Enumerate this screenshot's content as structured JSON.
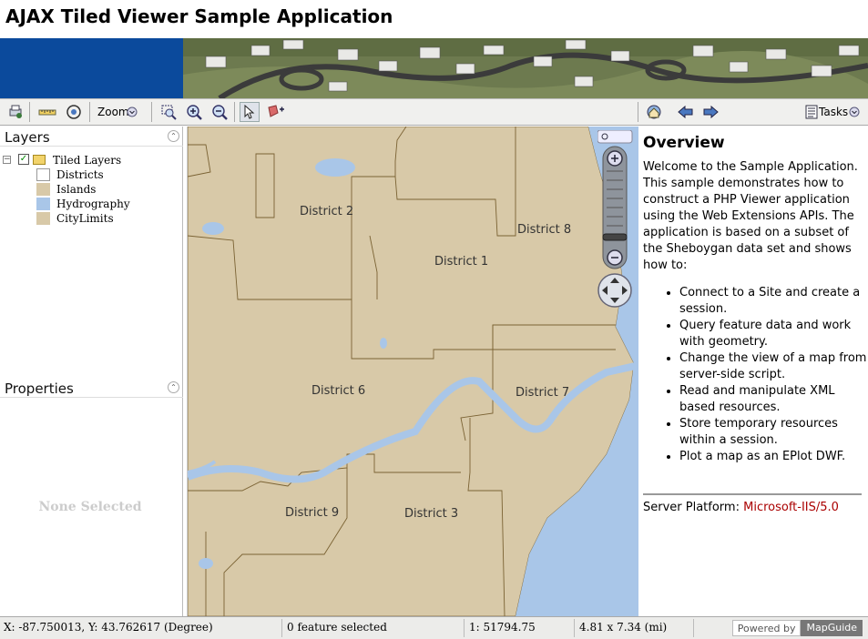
{
  "app": {
    "title": "AJAX Tiled Viewer Sample Application"
  },
  "toolbar": {
    "zoom_label": "Zoom",
    "tasks_label": "Tasks"
  },
  "layers_panel": {
    "title": "Layers",
    "group": "Tiled Layers",
    "layers": [
      {
        "label": "Districts",
        "color": "#ffffff"
      },
      {
        "label": "Islands",
        "color": "#d8c9a8"
      },
      {
        "label": "Hydrography",
        "color": "#a9c6e8"
      },
      {
        "label": "CityLimits",
        "color": "#d8c9a8"
      }
    ]
  },
  "properties_panel": {
    "title": "Properties",
    "empty_text": "None Selected"
  },
  "map": {
    "districts": [
      {
        "name": "District 2"
      },
      {
        "name": "District 8"
      },
      {
        "name": "District 1"
      },
      {
        "name": "District 6"
      },
      {
        "name": "District 7"
      },
      {
        "name": "District 9"
      },
      {
        "name": "District 3"
      }
    ],
    "colors": {
      "land": "#d8c9a8",
      "water": "#a9c6e8",
      "border": "#7a6233"
    }
  },
  "overview": {
    "title": "Overview",
    "intro": "Welcome to the Sample Application. This sample demonstrates how to construct a PHP Viewer application using the Web Extensions APIs. The application is based on a subset of the Sheboygan data set and shows how to:",
    "items": [
      "Connect to a Site and create a session.",
      "Query feature data and work with geometry.",
      "Change the view of a map from server-side script.",
      "Read and manipulate XML based resources.",
      "Store temporary resources within a session.",
      "Plot a map as an EPlot DWF."
    ],
    "server_label": "Server Platform:",
    "server_value": "Microsoft-IIS/5.0"
  },
  "status": {
    "coordinates": "X: -87.750013, Y: 43.762617 (Degree)",
    "selection": "0 feature selected",
    "scale": "1:  51794.75",
    "size": "4.81 x 7.34 (mi)",
    "powered_by": "Powered by",
    "brand": "MapGuide"
  }
}
